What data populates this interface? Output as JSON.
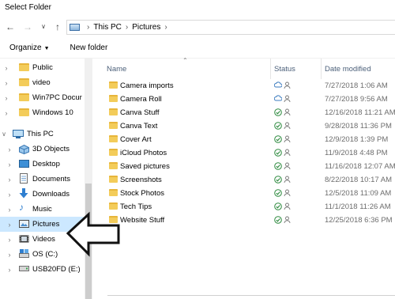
{
  "window": {
    "title": "Select Folder"
  },
  "address": {
    "crumbs": [
      "This PC",
      "Pictures"
    ]
  },
  "toolbar": {
    "organize_label": "Organize",
    "new_folder_label": "New folder"
  },
  "nav": {
    "items": [
      {
        "label": "Public",
        "icon": "folder-icon"
      },
      {
        "label": "video",
        "icon": "folder-icon"
      },
      {
        "label": "Win7PC Docur",
        "icon": "folder-icon"
      },
      {
        "label": "Windows 10",
        "icon": "folder-icon"
      },
      {
        "label": "This PC",
        "icon": "computer-icon"
      },
      {
        "label": "3D Objects",
        "icon": "3d-objects-icon"
      },
      {
        "label": "Desktop",
        "icon": "desktop-icon"
      },
      {
        "label": "Documents",
        "icon": "documents-icon"
      },
      {
        "label": "Downloads",
        "icon": "downloads-icon"
      },
      {
        "label": "Music",
        "icon": "music-icon"
      },
      {
        "label": "Pictures",
        "icon": "pictures-icon"
      },
      {
        "label": "Videos",
        "icon": "videos-icon"
      },
      {
        "label": "OS (C:)",
        "icon": "drive-icon"
      },
      {
        "label": "USB20FD (E:)",
        "icon": "usb-drive-icon"
      }
    ],
    "selected": "Pictures"
  },
  "columns": {
    "name": "Name",
    "status": "Status",
    "date": "Date modified"
  },
  "files": [
    {
      "name": "Camera imports",
      "status": "cloud",
      "date": "7/27/2018 1:06 AM"
    },
    {
      "name": "Camera Roll",
      "status": "cloud",
      "date": "7/27/2018 9:56 AM"
    },
    {
      "name": "Canva Stuff",
      "status": "synced",
      "date": "12/16/2018 11:21 AM"
    },
    {
      "name": "Canva Text",
      "status": "synced",
      "date": "9/28/2018 11:36 PM"
    },
    {
      "name": "Cover Art",
      "status": "synced",
      "date": "12/9/2018 1:39 PM"
    },
    {
      "name": "iCloud Photos",
      "status": "synced",
      "date": "11/9/2018 4:48 PM"
    },
    {
      "name": "Saved pictures",
      "status": "synced",
      "date": "11/16/2018 12:07 AM"
    },
    {
      "name": "Screenshots",
      "status": "synced",
      "date": "8/22/2018 10:17 AM"
    },
    {
      "name": "Stock Photos",
      "status": "synced",
      "date": "12/5/2018 11:09 AM"
    },
    {
      "name": "Tech Tips",
      "status": "synced",
      "date": "11/1/2018 11:26 AM"
    },
    {
      "name": "Website Stuff",
      "status": "synced",
      "date": "12/25/2018 6:36 PM"
    }
  ],
  "colors": {
    "selection": "#cce8ff",
    "folder": "#f3cc5a",
    "synced": "#2d8a3e",
    "cloud": "#3b7bbf"
  }
}
